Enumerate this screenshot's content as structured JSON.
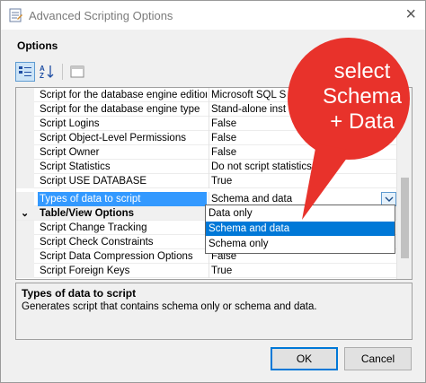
{
  "window": {
    "title": "Advanced Scripting Options"
  },
  "section": {
    "label": "Options"
  },
  "toolbar": {
    "categorized": "categorized-view",
    "alphabetical": "AZ",
    "pages": "property-pages"
  },
  "grid": {
    "rows": [
      {
        "name": "Script for the database engine edition",
        "value": "Microsoft SQL S"
      },
      {
        "name": "Script for the database engine type",
        "value": "Stand-alone inst"
      },
      {
        "name": "Script Logins",
        "value": "False"
      },
      {
        "name": "Script Object-Level Permissions",
        "value": "False"
      },
      {
        "name": "Script Owner",
        "value": "False"
      },
      {
        "name": "Script Statistics",
        "value": "Do not script statistics"
      },
      {
        "name": "Script USE DATABASE",
        "value": "True"
      },
      {
        "name": "Types of data to script",
        "value": "Schema and data"
      }
    ],
    "category": {
      "chevron": "⌄",
      "label": "Table/View Options"
    },
    "rows2": [
      {
        "name": "Script Change Tracking",
        "value": ""
      },
      {
        "name": "Script Check Constraints",
        "value": ""
      },
      {
        "name": "Script Data Compression Options",
        "value": "False"
      },
      {
        "name": "Script Foreign Keys",
        "value": "True"
      }
    ]
  },
  "dropdown": {
    "options": [
      "Data only",
      "Schema and data",
      "Schema only"
    ],
    "selected": "Schema and data"
  },
  "description": {
    "title": "Types of data to script",
    "text": "Generates script that contains schema only or schema and data."
  },
  "buttons": {
    "ok": "OK",
    "cancel": "Cancel"
  },
  "callout": {
    "line1": "select",
    "line2": "Schema",
    "line3": "+ Data",
    "color": "#e8322b"
  },
  "colors": {
    "selection": "#3399ff",
    "highlight": "#0078d7"
  }
}
